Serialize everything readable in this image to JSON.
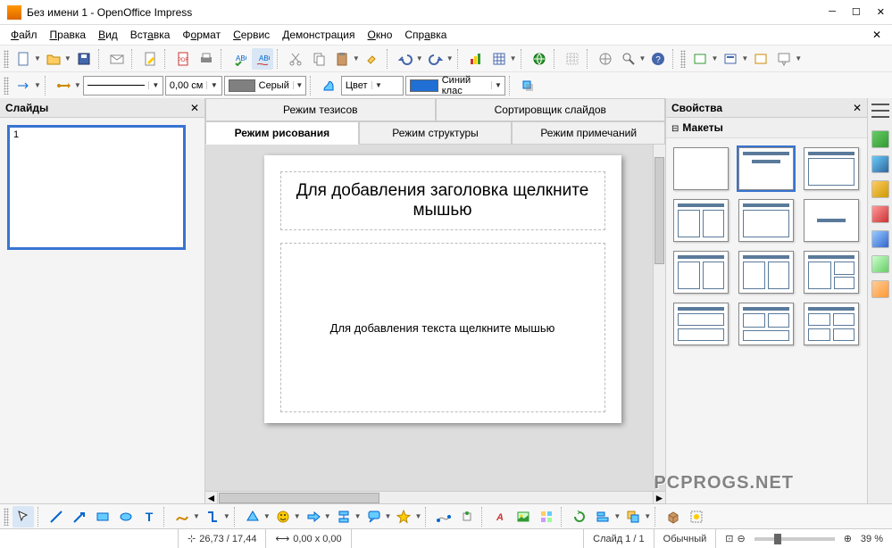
{
  "window": {
    "title": "Без имени 1 - OpenOffice Impress"
  },
  "menu": {
    "file": "Файл",
    "edit": "Правка",
    "view": "Вид",
    "insert": "Вставка",
    "format": "Формат",
    "tools": "Сервис",
    "slideshow": "Демонстрация",
    "window": "Окно",
    "help": "Справка"
  },
  "toolbar2": {
    "width": "0,00 см",
    "colorname": "Серый",
    "fillmode": "Цвет",
    "fillcolor": "Синий клас"
  },
  "panels": {
    "slides": "Слайды",
    "properties": "Свойства",
    "layouts": "Макеты"
  },
  "tabs": {
    "thesis": "Режим тезисов",
    "sorter": "Сортировщик слайдов",
    "drawing": "Режим рисования",
    "outline": "Режим структуры",
    "notes": "Режим примечаний"
  },
  "slide": {
    "num": "1",
    "titleprompt": "Для добавления заголовка щелкните мышью",
    "contentprompt": "Для добавления текста щелкните мышью"
  },
  "status": {
    "pos": "26,73 / 17,44",
    "size": "0,00 x 0,00",
    "slide": "Слайд 1 / 1",
    "mode": "Обычный",
    "zoom": "39 %"
  },
  "watermark": "PCPROGS.NET"
}
